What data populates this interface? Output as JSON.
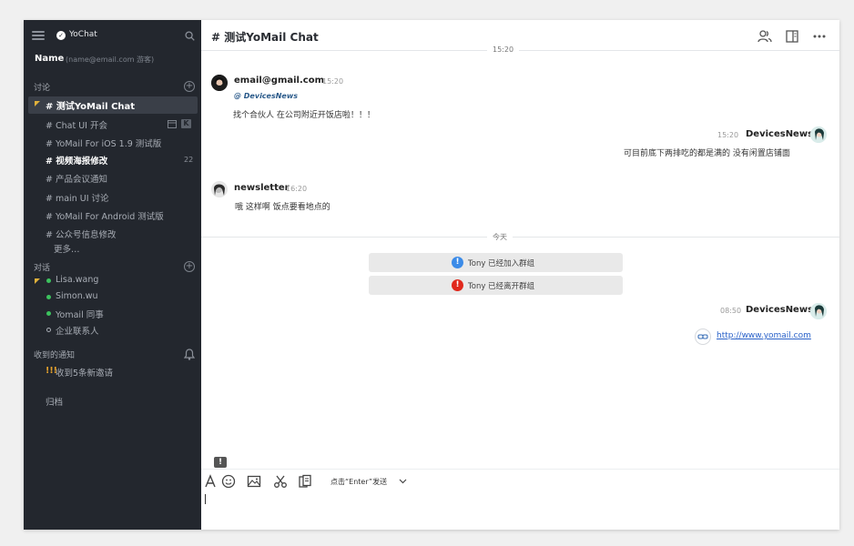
{
  "app": {
    "title": "YoChat"
  },
  "user": {
    "name": "Name",
    "email": "(name@email.com 游客)"
  },
  "sidebar": {
    "discussions_title": "讨论",
    "channels": [
      {
        "label": "# 测试YoMail Chat"
      },
      {
        "label": "# Chat UI 开会"
      },
      {
        "label": "# YoMail For iOS 1.9 测试版"
      },
      {
        "label": "# 视频海报修改",
        "badge": "22"
      },
      {
        "label": "# 产品会议通知"
      },
      {
        "label": "# main UI 讨论"
      },
      {
        "label": "# YoMail For Android 测试版"
      },
      {
        "label": "# 公众号信息修改"
      }
    ],
    "more": "更多…",
    "conversations_title": "对话",
    "contacts": [
      {
        "label": "Lisa.wang"
      },
      {
        "label": "Simon.wu"
      },
      {
        "label": "Yomail 同事"
      },
      {
        "label": "企业联系人"
      }
    ],
    "notifications_title": "收到的通知",
    "notification_item": "收到5条新邀请",
    "notification_prefix": "!!!",
    "archive": "归档"
  },
  "header": {
    "title": "# 测试YoMail Chat"
  },
  "messages": {
    "time_divider": "15:20",
    "m1": {
      "sender": "email@gmail.com",
      "time": "15:20",
      "mention": "@ DevicesNews",
      "text": "找个合伙人 在公司附近开饭店啦！！！"
    },
    "m2": {
      "sender": "DevicesNews",
      "time": "15:20",
      "text": "可目前底下两排吃的都是满的 没有闲置店铺面"
    },
    "m3": {
      "sender": "newsletter",
      "time": "16:20",
      "text": "哦 这样啊 饭点要看地点的"
    },
    "today_divider": "今天",
    "notice_join": "Tony 已经加入群组",
    "notice_leave": "Tony 已经离开群组",
    "m4": {
      "sender": "DevicesNews",
      "time": "08:50",
      "link": "http://www.yomail.com"
    }
  },
  "composer": {
    "send_hint": "点击“Enter”发送"
  },
  "colors": {
    "sidebar_bg": "#23272e",
    "accent_blue": "#3b8be8",
    "alert_red": "#e0281c",
    "flag_yellow": "#e0b13b",
    "online_green": "#3cc25e"
  }
}
